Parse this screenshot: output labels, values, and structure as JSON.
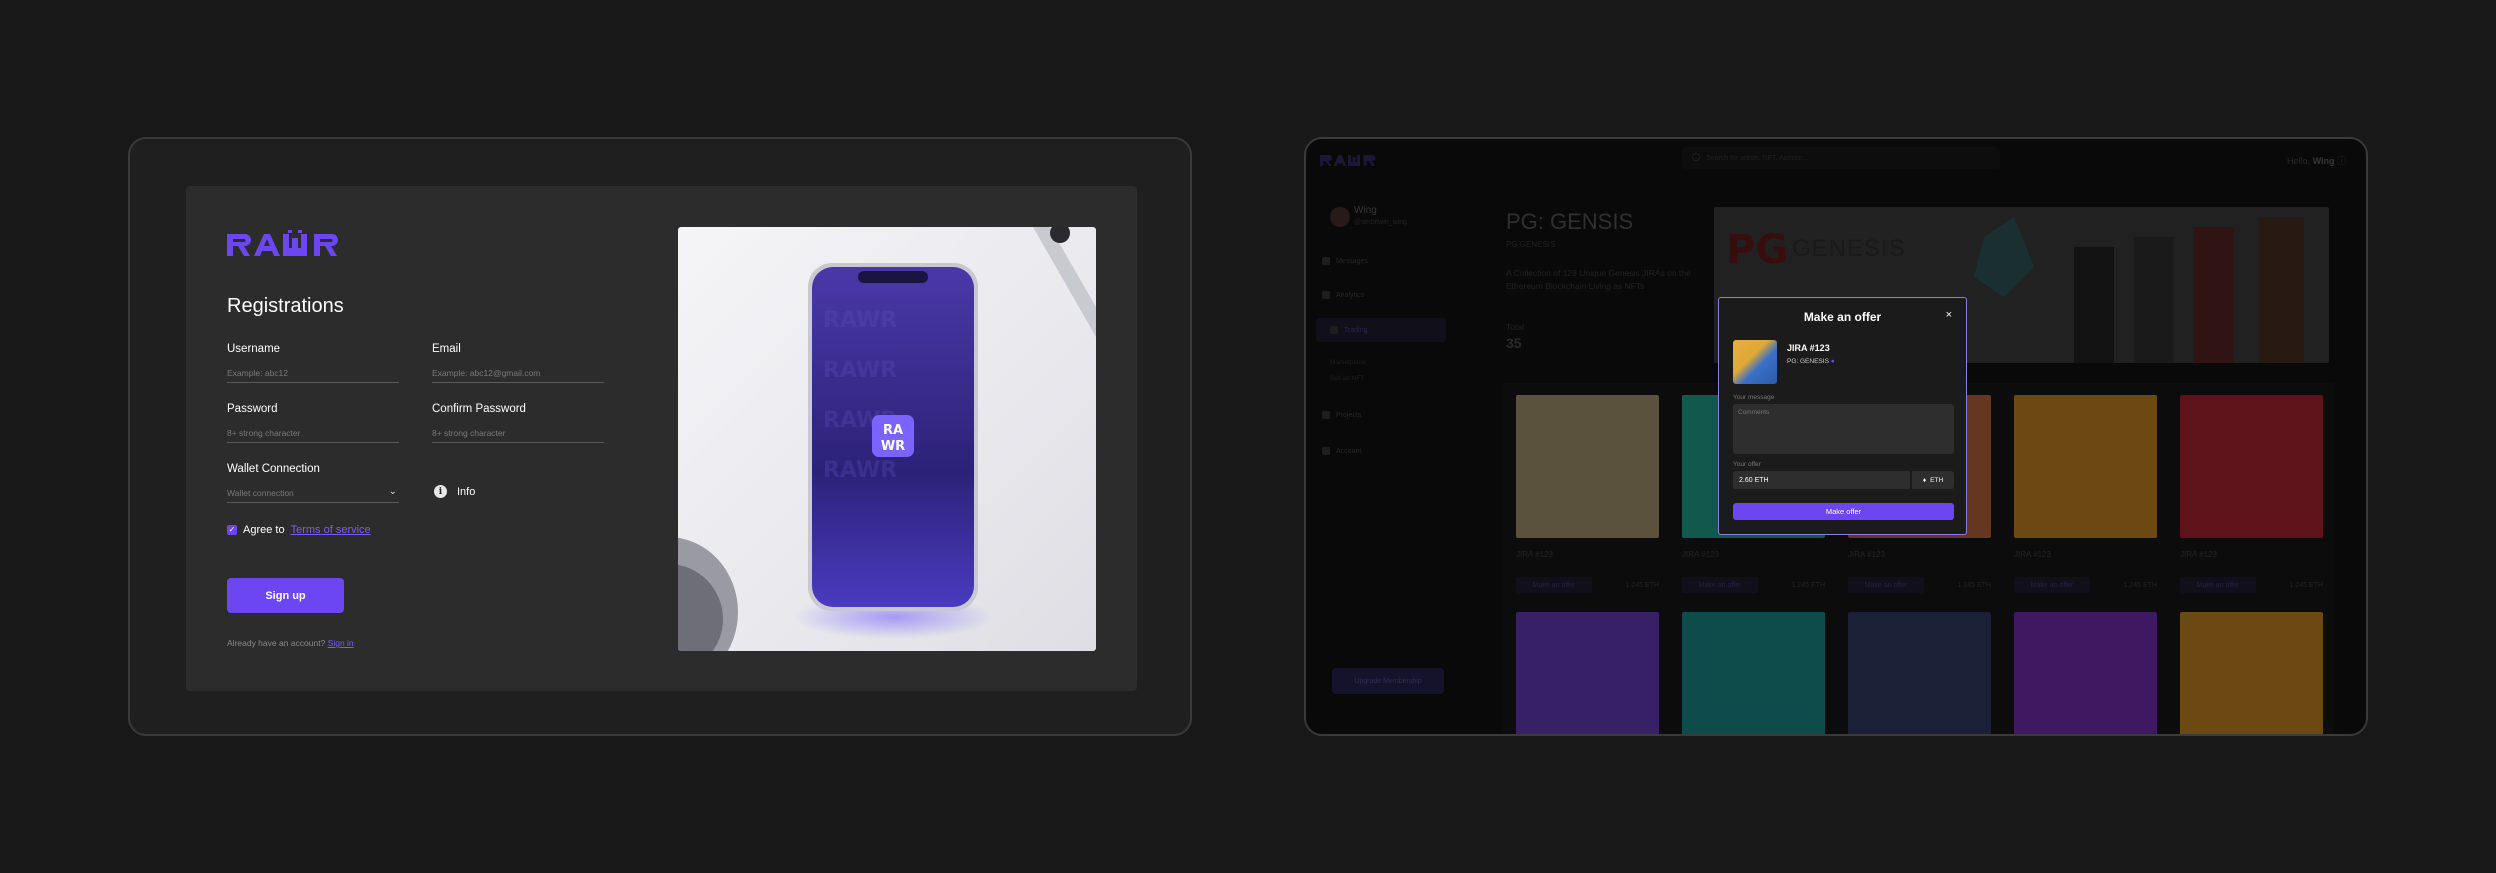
{
  "registration": {
    "logo_text": "RAWR",
    "title": "Registrations",
    "fields": {
      "username": {
        "label": "Username",
        "placeholder": "Example: abc12"
      },
      "email": {
        "label": "Email",
        "placeholder": "Example: abc12@gmail.com"
      },
      "password": {
        "label": "Password",
        "placeholder": "8+ strong character"
      },
      "confirm_password": {
        "label": "Confirm Password",
        "placeholder": "8+ strong character"
      },
      "wallet": {
        "label": "Wallet Connection",
        "placeholder": "Wallet connection"
      }
    },
    "info_label": "Info",
    "agree_prefix": "Agree to",
    "terms_link": "Terms of service",
    "signup_button": "Sign up",
    "have_account": "Already have an account?",
    "signin_link": "Sign in",
    "phone_logo": [
      "RA",
      "WR"
    ],
    "colors": {
      "accent": "#6c46f2",
      "card": "#2c2c2c"
    }
  },
  "app": {
    "search_placeholder": "Search for artists, NFT, Auction...",
    "hello": "Hello,",
    "hello_name": "Wing",
    "user": {
      "name": "Wing",
      "handle": "@ambitwin_wing"
    },
    "nav": [
      "Messages",
      "Analytics",
      "Trading",
      "Projects",
      "Account"
    ],
    "sub_nav": [
      "Marketplace",
      "Sell an NFT"
    ],
    "upgrade_button": "Upgrade Membership",
    "collection": {
      "title": "PG: GENSIS",
      "subtitle": "PG GENESIS",
      "description": "A Collection of 128 Unique Genesis JIRAs on the Ethereum Blockchain Living as NFTs",
      "total_label": "Total",
      "total_value": "35",
      "banner_pg": "PG",
      "banner_text": "GENESIS"
    },
    "tiles": [
      {
        "name": "JIRA #123",
        "button": "Make an offer",
        "price": "1.245 ETH",
        "color": "#c9b78a"
      },
      {
        "name": "JIRA #123",
        "button": "Make an offer",
        "price": "1.245 ETH",
        "color": "#28c4a8"
      },
      {
        "name": "JIRA #123",
        "button": "Make an offer",
        "price": "1.245 ETH",
        "color": "#e07a4a"
      },
      {
        "name": "JIRA #123",
        "button": "Make an offer",
        "price": "1.245 ETH",
        "color": "#f0a028"
      },
      {
        "name": "JIRA #123",
        "button": "Make an offer",
        "price": "1.245 ETH",
        "color": "#d02838"
      }
    ],
    "tiles_row2": [
      {
        "color": "#7a48e0"
      },
      {
        "color": "#20a8a8"
      },
      {
        "color": "#3a4a78"
      },
      {
        "color": "#8a38d8"
      },
      {
        "color": "#f0a028"
      }
    ],
    "modal": {
      "title": "Make an offer",
      "close": "×",
      "item_name": "JIRA #123",
      "collection": "PG: GENESIS",
      "message_label": "Your message",
      "message_placeholder": "Comments",
      "offer_label": "Your offer",
      "offer_value": "2.60 ETH",
      "currency": "ETH",
      "submit": "Make offer"
    }
  }
}
